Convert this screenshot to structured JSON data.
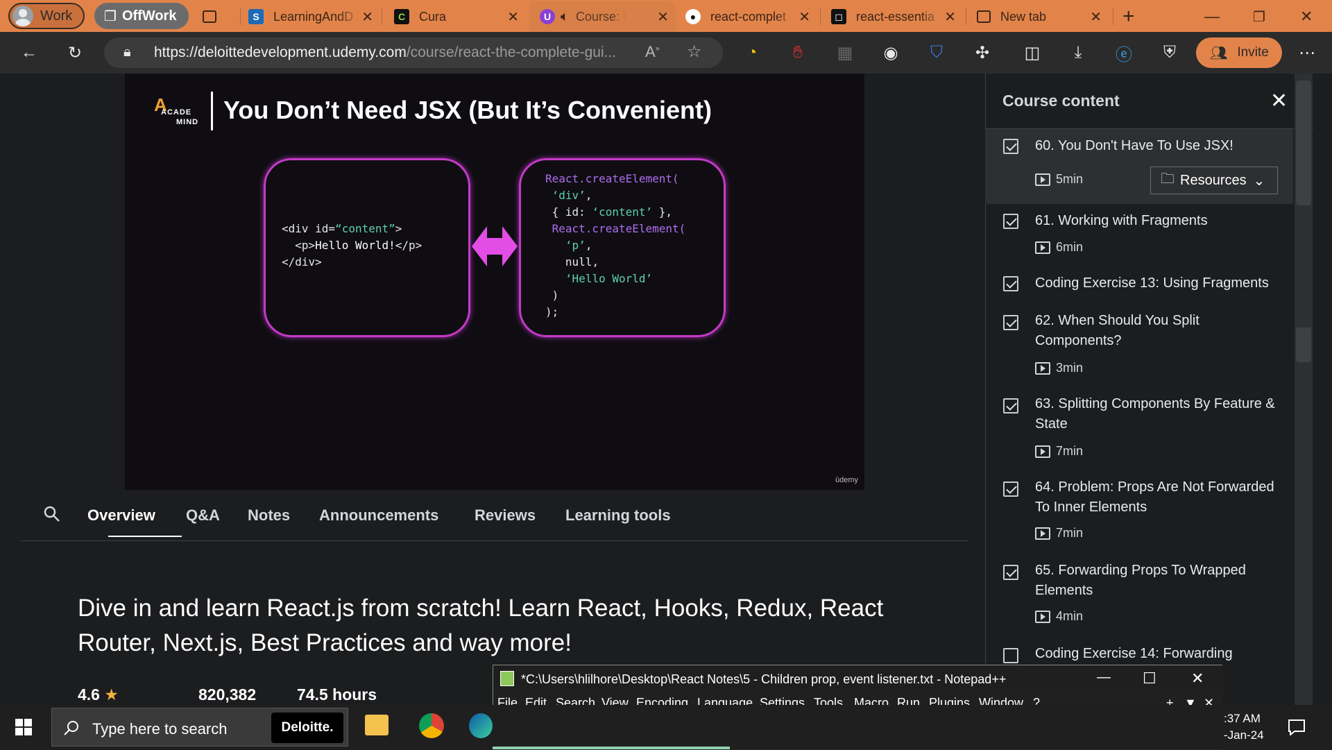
{
  "browser": {
    "profiles": {
      "work": "Work",
      "offwork": "OffWork"
    },
    "tabs": [
      {
        "label": "LearningAndD",
        "icon": "sharepoint-icon"
      },
      {
        "label": "Cura",
        "icon": "cura-icon"
      },
      {
        "label": "Course: R",
        "icon": "udemy-icon"
      },
      {
        "label": "react-complet",
        "icon": "github-icon"
      },
      {
        "label": "react-essentia",
        "icon": "codesandbox-icon"
      },
      {
        "label": "New tab",
        "icon": "newtab-icon"
      }
    ],
    "url_host": "https://deloittedevelopment.udemy.com",
    "url_path": "/course/react-the-complete-gui...",
    "invite_label": "Invite"
  },
  "slide": {
    "logo_line1": "ACADE",
    "logo_line2": "MIND",
    "title": "You Don’t Need JSX (But It’s Convenient)",
    "jsx_code": "<div id=“content”>\n  <p>Hello World!</p>\n</div>",
    "create_code": "React.createElement(\n ‘div’,\n { id: ‘content’ },\n React.createElement(\n   ‘p’,\n   null,\n   ‘Hello World’\n )\n);",
    "watermark": "ūdemy"
  },
  "course_tabs": [
    "Overview",
    "Q&A",
    "Notes",
    "Announcements",
    "Reviews",
    "Learning tools"
  ],
  "headline": "Dive in and learn React.js from scratch! Learn React, Hooks, Redux, React Router, Next.js, Best Practices and way more!",
  "stats": {
    "rating": "4.6",
    "students": "820,382",
    "hours": "74.5 hours"
  },
  "sidebar": {
    "title": "Course content",
    "resources_label": "Resources",
    "lessons": [
      {
        "title": "60. You Don't Have To Use JSX!",
        "duration": "5min",
        "checked": true
      },
      {
        "title": "61. Working with Fragments",
        "duration": "6min",
        "checked": true
      },
      {
        "title": "Coding Exercise 13: Using Fragments",
        "duration": "",
        "checked": true
      },
      {
        "title": "62. When Should You Split Components?",
        "duration": "3min",
        "checked": true
      },
      {
        "title": "63. Splitting Components By Feature & State",
        "duration": "7min",
        "checked": true
      },
      {
        "title": "64. Problem: Props Are Not Forwarded To Inner Elements",
        "duration": "7min",
        "checked": true
      },
      {
        "title": "65. Forwarding Props To Wrapped Elements",
        "duration": "4min",
        "checked": true
      },
      {
        "title": "Coding Exercise 14: Forwarding",
        "duration": "",
        "checked": false
      }
    ]
  },
  "notepad": {
    "title": "*C:\\Users\\hlilhore\\Desktop\\React Notes\\5 - Children prop, event listener.txt - Notepad++",
    "menu": [
      "File",
      "Edit",
      "Search",
      "View",
      "Encoding",
      "Language",
      "Settings",
      "Tools",
      "Macro",
      "Run",
      "Plugins",
      "Window",
      "?"
    ]
  },
  "taskbar": {
    "search_placeholder": "Type here to search",
    "deloitte": "Deloitte.",
    "time": ":37 AM",
    "date": "-Jan-24"
  }
}
